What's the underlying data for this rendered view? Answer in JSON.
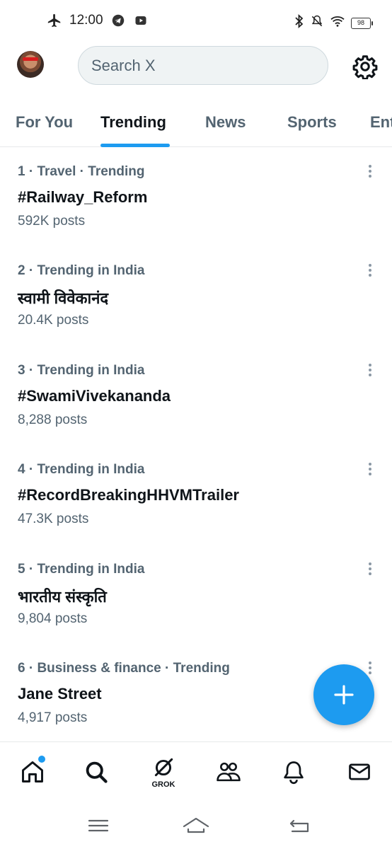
{
  "status_bar": {
    "time": "12:00",
    "battery": "98"
  },
  "search": {
    "placeholder": "Search X"
  },
  "tabs": [
    {
      "label": "For You"
    },
    {
      "label": "Trending"
    },
    {
      "label": "News"
    },
    {
      "label": "Sports"
    },
    {
      "label": "Ent"
    }
  ],
  "trends": [
    {
      "meta": "1 · Travel · Trending",
      "title": "#Railway_Reform",
      "posts": "592K posts"
    },
    {
      "meta": "2 · Trending in India",
      "title": "स्वामी विवेकानंद",
      "posts": "20.4K posts"
    },
    {
      "meta": "3 · Trending in India",
      "title": "#SwamiVivekananda",
      "posts": "8,288 posts"
    },
    {
      "meta": "4 · Trending in India",
      "title": "#RecordBreakingHHVMTrailer",
      "posts": "47.3K posts"
    },
    {
      "meta": "5 · Trending in India",
      "title": "भारतीय संस्कृति",
      "posts": "9,804 posts"
    },
    {
      "meta": "6 · Business & finance · Trending",
      "title": "Jane Street",
      "posts": "4,917 posts"
    }
  ],
  "bottom_nav": {
    "grok_label": "GROK",
    "items": [
      "home-icon",
      "search-icon",
      "grok-icon",
      "communities-icon",
      "notifications-icon",
      "messages-icon"
    ]
  },
  "colors": {
    "accent": "#1d9bf0",
    "text": "#0f1419",
    "secondary": "#536471"
  }
}
